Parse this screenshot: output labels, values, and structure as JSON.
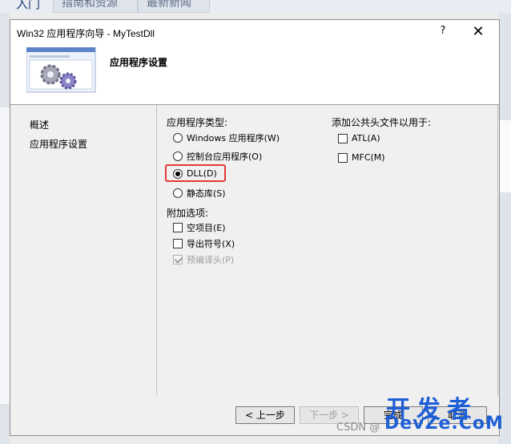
{
  "background": {
    "active_tab": "入门",
    "tabs": [
      "指南和资源",
      "最新新闻"
    ]
  },
  "dialog": {
    "title": "Win32 应用程序向导 - MyTestDll",
    "help_label": "?",
    "close_label": "✕",
    "header_title": "应用程序设置",
    "header_icon": "gears-wizard-icon"
  },
  "nav": {
    "items": [
      "概述",
      "应用程序设置"
    ]
  },
  "app_type": {
    "label": "应用程序类型:",
    "options": [
      "Windows 应用程序(W)",
      "控制台应用程序(O)",
      "DLL(D)",
      "静态库(S)"
    ],
    "selected": "DLL(D)"
  },
  "extra": {
    "label": "附加选项:",
    "options": [
      "空项目(E)",
      "导出符号(X)",
      "预编译头(P)"
    ]
  },
  "headers": {
    "label": "添加公共头文件以用于:",
    "options": [
      "ATL(A)",
      "MFC(M)"
    ]
  },
  "footer": {
    "prev": "< 上一步",
    "next": "下一步 >",
    "finish": "完成",
    "cancel": "取消"
  },
  "watermark": {
    "cn": "开发者",
    "en": "DevZe.CoM",
    "csdn": "CSDN @"
  },
  "colors": {
    "highlight": "#e53935",
    "watermark": "#1f5fd6"
  }
}
